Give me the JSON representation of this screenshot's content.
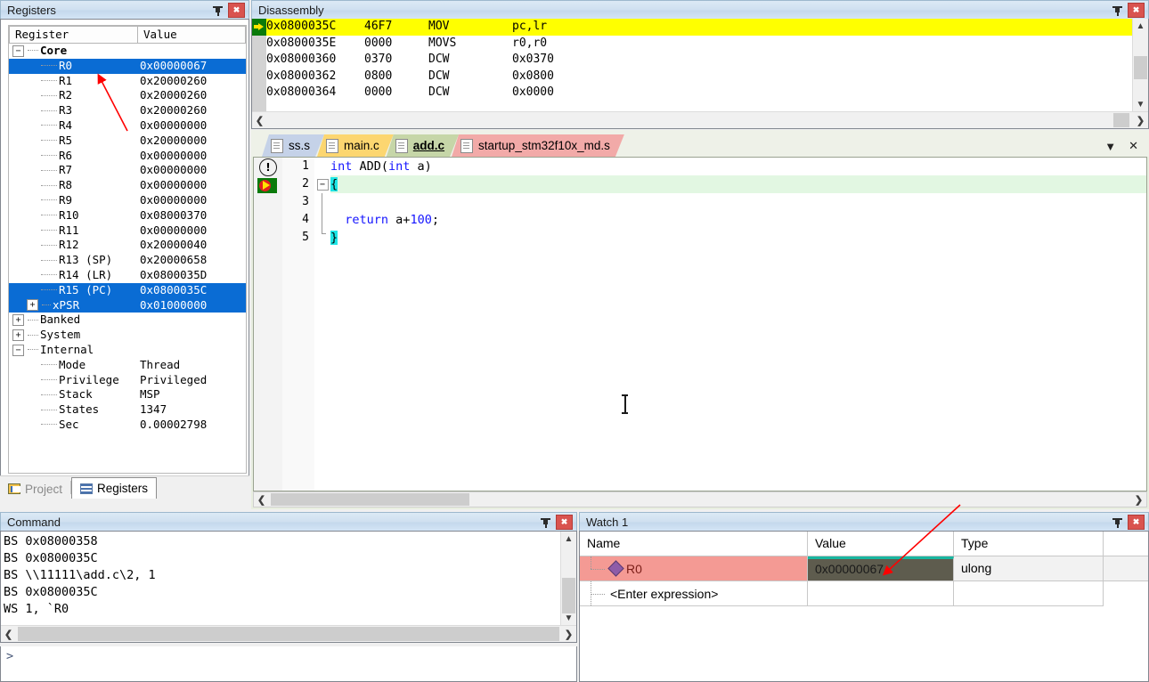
{
  "registers": {
    "title": "Registers",
    "columns": [
      "Register",
      "Value"
    ],
    "groups": [
      {
        "name": "Core",
        "expanded": true,
        "rows": [
          {
            "name": "R0",
            "value": "0x00000067",
            "selected": true
          },
          {
            "name": "R1",
            "value": "0x20000260"
          },
          {
            "name": "R2",
            "value": "0x20000260"
          },
          {
            "name": "R3",
            "value": "0x20000260"
          },
          {
            "name": "R4",
            "value": "0x00000000"
          },
          {
            "name": "R5",
            "value": "0x20000000"
          },
          {
            "name": "R6",
            "value": "0x00000000"
          },
          {
            "name": "R7",
            "value": "0x00000000"
          },
          {
            "name": "R8",
            "value": "0x00000000"
          },
          {
            "name": "R9",
            "value": "0x00000000"
          },
          {
            "name": "R10",
            "value": "0x08000370"
          },
          {
            "name": "R11",
            "value": "0x00000000"
          },
          {
            "name": "R12",
            "value": "0x20000040"
          },
          {
            "name": "R13 (SP)",
            "value": "0x20000658"
          },
          {
            "name": "R14 (LR)",
            "value": "0x0800035D"
          },
          {
            "name": "R15 (PC)",
            "value": "0x0800035C",
            "selected": true
          },
          {
            "name": "xPSR",
            "value": "0x01000000",
            "selected": true,
            "twisty": "+"
          }
        ]
      },
      {
        "name": "Banked",
        "expanded": false,
        "rows": []
      },
      {
        "name": "System",
        "expanded": false,
        "rows": []
      },
      {
        "name": "Internal",
        "expanded": true,
        "rows": [
          {
            "name": "Mode",
            "value": "Thread"
          },
          {
            "name": "Privilege",
            "value": "Privileged"
          },
          {
            "name": "Stack",
            "value": "MSP"
          },
          {
            "name": "States",
            "value": "1347"
          },
          {
            "name": "Sec",
            "value": "0.00002798"
          }
        ]
      }
    ],
    "bottom_tabs": [
      {
        "label": "Project",
        "icon": "project-icon",
        "active": false
      },
      {
        "label": "Registers",
        "icon": "registers-icon",
        "active": true
      }
    ]
  },
  "disassembly": {
    "title": "Disassembly",
    "rows": [
      {
        "addr": "0x0800035C",
        "opcode": "46F7",
        "mnemonic": "MOV",
        "args": "pc,lr",
        "current": true
      },
      {
        "addr": "0x0800035E",
        "opcode": "0000",
        "mnemonic": "MOVS",
        "args": "r0,r0"
      },
      {
        "addr": "0x08000360",
        "opcode": "0370",
        "mnemonic": "DCW",
        "args": "0x0370"
      },
      {
        "addr": "0x08000362",
        "opcode": "0800",
        "mnemonic": "DCW",
        "args": "0x0800"
      },
      {
        "addr": "0x08000364",
        "opcode": "0000",
        "mnemonic": "DCW",
        "args": "0x0000"
      }
    ]
  },
  "editor": {
    "tabs": [
      {
        "label": "ss.s",
        "color": "#c5d2e8",
        "active": false
      },
      {
        "label": "main.c",
        "color": "#fcd670",
        "active": false
      },
      {
        "label": "add.c",
        "color": "#c6d6a8",
        "active": true
      },
      {
        "label": "startup_stm32f10x_md.s",
        "color": "#f2aaa8",
        "active": false
      }
    ],
    "tools": {
      "dropdown": "▼",
      "close": "✕"
    },
    "lines": [
      {
        "n": "1",
        "text": "int ADD(int a)"
      },
      {
        "n": "2",
        "text": "{",
        "highlight": true,
        "breakpoint": true
      },
      {
        "n": "3",
        "text": ""
      },
      {
        "n": "4",
        "text": "return a+100;"
      },
      {
        "n": "5",
        "text": "}"
      }
    ]
  },
  "command": {
    "title": "Command",
    "lines": [
      "BS 0x08000358",
      "BS 0x0800035C",
      "BS \\\\11111\\add.c\\2, 1",
      "BS 0x0800035C",
      "WS 1, `R0"
    ],
    "prompt": ">"
  },
  "watch": {
    "title": "Watch 1",
    "columns": [
      "Name",
      "Value",
      "Type",
      ""
    ],
    "rows": [
      {
        "name": "R0",
        "value": "0x00000067",
        "type": "ulong",
        "selected": true
      },
      {
        "name": "<Enter expression>",
        "value": "",
        "type": ""
      }
    ]
  },
  "colors": {
    "accent_select": "#0a6cd4",
    "current_line": "#ffff00",
    "watch_row_highlight": "#f49a94",
    "watch_cell_selected": "#5e5c4e",
    "watch_cell_border": "#19b6a0",
    "close_button": "#d9534f",
    "annotation_arrow": "#ff0000"
  }
}
